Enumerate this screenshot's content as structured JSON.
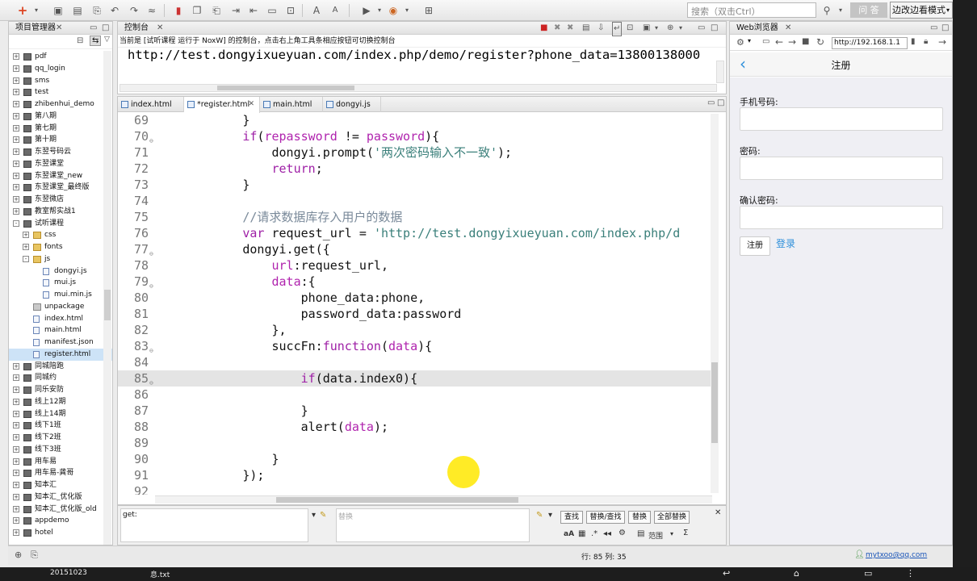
{
  "toolbar": {
    "search_placeholder": "搜索（双击Ctrl）",
    "ask_label": "问 答",
    "mode_label": "边改边看模式"
  },
  "project_panel": {
    "title": "项目管理器",
    "items": [
      {
        "label": "pdf"
      },
      {
        "label": "qq_login"
      },
      {
        "label": "sms"
      },
      {
        "label": "test"
      },
      {
        "label": "zhibenhui_demo"
      },
      {
        "label": "第八期"
      },
      {
        "label": "第七期"
      },
      {
        "label": "第十期"
      },
      {
        "label": "东翌号码云"
      },
      {
        "label": "东翌课堂"
      },
      {
        "label": "东翌课堂_new"
      },
      {
        "label": "东翌课堂_最终版"
      },
      {
        "label": "东翌微店"
      },
      {
        "label": "教室帮实战1"
      },
      {
        "label": "试听课程"
      },
      {
        "label": "css"
      },
      {
        "label": "fonts"
      },
      {
        "label": "js"
      },
      {
        "label": "dongyi.js"
      },
      {
        "label": "mui.js"
      },
      {
        "label": "mui.min.js"
      },
      {
        "label": "unpackage"
      },
      {
        "label": "index.html"
      },
      {
        "label": "main.html"
      },
      {
        "label": "manifest.json"
      },
      {
        "label": "register.html"
      },
      {
        "label": "同城陪跑"
      },
      {
        "label": "同城约"
      },
      {
        "label": "同乐安防"
      },
      {
        "label": "线上12期"
      },
      {
        "label": "线上14期"
      },
      {
        "label": "线下1班"
      },
      {
        "label": "线下2班"
      },
      {
        "label": "线下3班"
      },
      {
        "label": "用车易"
      },
      {
        "label": "用车易-龚哥"
      },
      {
        "label": "知本汇"
      },
      {
        "label": "知本汇_优化版"
      },
      {
        "label": "知本汇_优化版_old"
      },
      {
        "label": "appdemo"
      },
      {
        "label": "hotel"
      }
    ]
  },
  "console": {
    "title": "控制台",
    "message": "当前是 [试听课程 运行于 NoxW] 的控制台，点击右上角工具条相应按钮可切换控制台",
    "output": "http://test.dongyixueyuan.com/index.php/demo/register?phone_data=13800138000"
  },
  "editor": {
    "tabs": [
      {
        "label": "index.html"
      },
      {
        "label": "*register.html"
      },
      {
        "label": "main.html"
      },
      {
        "label": "dongyi.js"
      }
    ],
    "lines": [
      {
        "n": "69",
        "text": "            }"
      },
      {
        "n": "70",
        "text": "            if(repassword != password){"
      },
      {
        "n": "71",
        "text": "                dongyi.prompt('两次密码输入不一致');"
      },
      {
        "n": "72",
        "text": "                return;"
      },
      {
        "n": "73",
        "text": "            }"
      },
      {
        "n": "74",
        "text": ""
      },
      {
        "n": "75",
        "text": "            //请求数据库存入用户的数据"
      },
      {
        "n": "76",
        "text": "            var request_url = 'http://test.dongyixueyuan.com/index.php/d"
      },
      {
        "n": "77",
        "text": "            dongyi.get({"
      },
      {
        "n": "78",
        "text": "                url:request_url,"
      },
      {
        "n": "79",
        "text": "                data:{"
      },
      {
        "n": "80",
        "text": "                    phone_data:phone,"
      },
      {
        "n": "81",
        "text": "                    password_data:password"
      },
      {
        "n": "82",
        "text": "                },"
      },
      {
        "n": "83",
        "text": "                succFn:function(data){"
      },
      {
        "n": "84",
        "text": ""
      },
      {
        "n": "85",
        "text": "                    if(data.index0){"
      },
      {
        "n": "86",
        "text": ""
      },
      {
        "n": "87",
        "text": "                    }"
      },
      {
        "n": "88",
        "text": "                    alert(data);"
      },
      {
        "n": "89",
        "text": ""
      },
      {
        "n": "90",
        "text": "                }"
      },
      {
        "n": "91",
        "text": "            });"
      },
      {
        "n": "92",
        "text": ""
      }
    ]
  },
  "find": {
    "find_value": "get:",
    "replace_placeholder": "替换",
    "buttons": [
      "查找",
      "替换/查找",
      "替换",
      "全部替换"
    ],
    "scope_label": "范围"
  },
  "browser": {
    "title": "Web浏览器",
    "url": "http://192.168.1.1",
    "page_title": "注册",
    "fields": [
      "手机号码:",
      "密码:",
      "确认密码:"
    ],
    "register_button": "注册",
    "login_link": "登录"
  },
  "status": {
    "position": "行: 85 列: 35",
    "user": "mytxoo@qq.com"
  },
  "taskbar": {
    "item1": "20151023",
    "item2": "息.txt"
  }
}
